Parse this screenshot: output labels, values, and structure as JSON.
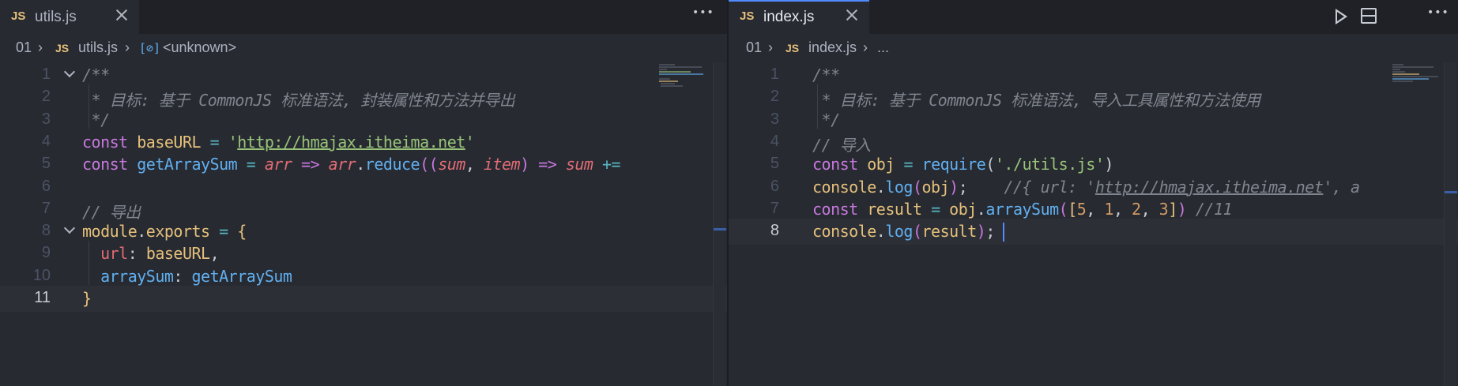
{
  "left": {
    "tab": {
      "lang": "JS",
      "filename": "utils.js"
    },
    "breadcrumb": {
      "folder": "01",
      "lang": "JS",
      "file": "utils.js",
      "symbol": "<unknown>"
    },
    "lines": [
      {
        "n": "1",
        "html": "<span class=\"c-comment\">/**</span>"
      },
      {
        "n": "2",
        "html": "<span class=\"c-comment\"> * 目标: 基于 CommonJS 标准语法, 封装属性和方法并导出</span>"
      },
      {
        "n": "3",
        "html": "<span class=\"c-comment\"> */</span>"
      },
      {
        "n": "4",
        "html": "<span class=\"c-kw\">const</span> <span class=\"c-var\">baseURL</span> <span class=\"c-op\">=</span> <span class=\"c-str\">'</span><span class=\"c-link\">http://hmajax.itheima.net</span><span class=\"c-str\">'</span>"
      },
      {
        "n": "5",
        "html": "<span class=\"c-kw\">const</span> <span class=\"c-fn\">getArraySum</span> <span class=\"c-op\">=</span> <span class=\"c-param\">arr</span> <span class=\"c-kw\">=&gt;</span> <span class=\"c-param\">arr</span><span class=\"c-plain\">.</span><span class=\"c-fn\">reduce</span><span class=\"c-paren\">((</span><span class=\"c-param\">sum</span><span class=\"c-plain\">, </span><span class=\"c-param\">item</span><span class=\"c-paren\">)</span> <span class=\"c-kw\">=&gt;</span> <span class=\"c-param\">sum</span> <span class=\"c-op\">+=</span>"
      },
      {
        "n": "6",
        "html": ""
      },
      {
        "n": "7",
        "html": "<span class=\"c-comment\">// 导出</span>"
      },
      {
        "n": "8",
        "html": "<span class=\"c-var\">module</span><span class=\"c-plain\">.</span><span class=\"c-var\">exports</span> <span class=\"c-op\">=</span> <span class=\"c-brace\">{</span>"
      },
      {
        "n": "9",
        "html": "  <span class=\"c-prop\">url</span><span class=\"c-plain\">: </span><span class=\"c-var\">baseURL</span><span class=\"c-plain\">,</span>"
      },
      {
        "n": "10",
        "html": "  <span class=\"c-fn\">arraySum</span><span class=\"c-plain\">: </span><span class=\"c-fn\">getArraySum</span>"
      },
      {
        "n": "11",
        "html": "<span class=\"c-brace\">}</span>"
      }
    ]
  },
  "right": {
    "tab": {
      "lang": "JS",
      "filename": "index.js"
    },
    "breadcrumb": {
      "folder": "01",
      "lang": "JS",
      "file": "index.js",
      "symbol": "..."
    },
    "lines": [
      {
        "n": "1",
        "html": "<span class=\"c-comment\">/**</span>"
      },
      {
        "n": "2",
        "html": "<span class=\"c-comment\"> * 目标: 基于 CommonJS 标准语法, 导入工具属性和方法使用</span>"
      },
      {
        "n": "3",
        "html": "<span class=\"c-comment\"> */</span>"
      },
      {
        "n": "4",
        "html": "<span class=\"c-comment\">// 导入</span>"
      },
      {
        "n": "5",
        "html": "<span class=\"c-kw\">const</span> <span class=\"c-var\">obj</span> <span class=\"c-op\">=</span> <span class=\"c-fn\">require</span><span class=\"c-plain\">(</span><span class=\"c-str\">'./utils.js'</span><span class=\"c-plain\">)</span>"
      },
      {
        "n": "6",
        "html": "<span class=\"c-var\">console</span><span class=\"c-plain\">.</span><span class=\"c-fn\">log</span><span class=\"c-paren\">(</span><span class=\"c-var\">obj</span><span class=\"c-paren\">)</span><span class=\"c-plain\">;</span>    <span class=\"c-comment\">//{ url: '<span style=\"text-decoration:underline\">http://hmajax.itheima.net</span>', a</span>"
      },
      {
        "n": "7",
        "html": "<span class=\"c-kw\">const</span> <span class=\"c-var\">result</span> <span class=\"c-op\">=</span> <span class=\"c-var\">obj</span><span class=\"c-plain\">.</span><span class=\"c-fn\">arraySum</span><span class=\"c-paren\">(</span><span class=\"c-brace\">[</span><span class=\"c-num\">5</span><span class=\"c-plain\">, </span><span class=\"c-num\">1</span><span class=\"c-plain\">, </span><span class=\"c-num\">2</span><span class=\"c-plain\">, </span><span class=\"c-num\">3</span><span class=\"c-brace\">]</span><span class=\"c-paren\">)</span> <span class=\"c-comment\">//11</span>"
      },
      {
        "n": "8",
        "html": "<span class=\"c-var\">console</span><span class=\"c-plain\">.</span><span class=\"c-fn\">log</span><span class=\"c-paren\">(</span><span class=\"c-var\">result</span><span class=\"c-paren\">)</span><span class=\"c-plain\">;</span>"
      }
    ]
  },
  "icons": {
    "close": "close-icon",
    "more": "more-actions-icon",
    "run": "run-icon",
    "split": "split-editor-icon",
    "fold": "fold-chevron-icon",
    "breadcrumb_sep": "chevron-right-icon",
    "symbol": "symbol-icon"
  },
  "colors": {
    "keyword": "#c678dd",
    "variable": "#e5c07b",
    "function": "#61afef",
    "string": "#98c379",
    "comment": "#7f848e",
    "param": "#e06c75",
    "number": "#d19a66",
    "cursor": "#528bff"
  }
}
